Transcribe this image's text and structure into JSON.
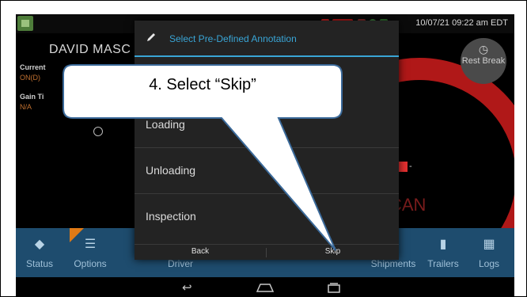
{
  "status_bar": {
    "clock": "10/07/21 09:22 am EDT"
  },
  "background": {
    "driver_name": "DAVID MASC",
    "current_label": "Current",
    "current_value": "ON(D)",
    "gain_label": "Gain Ti",
    "gain_value": "N/A",
    "can_text": "CAN",
    "flag_dash": "-",
    "rest_break": "Rest Break",
    "ring_color": "#b01818"
  },
  "dialog": {
    "title": "Select Pre-Defined Annotation",
    "items": [
      "Loading",
      "Unloading",
      "Inspection"
    ],
    "back_label": "Back",
    "skip_label": "Skip",
    "accent_color": "#39a5d6"
  },
  "bottom_bar": {
    "items": [
      {
        "label": "Status",
        "icon": "diamond-icon"
      },
      {
        "label": "Options",
        "icon": "list-icon"
      },
      {
        "label": "Driver",
        "icon": "driver-icon"
      },
      {
        "label": "Shipments",
        "icon": "box-icon"
      },
      {
        "label": "Trailers",
        "icon": "trailer-icon"
      },
      {
        "label": "Logs",
        "icon": "book-icon"
      }
    ],
    "bar_color": "#1e4c6e"
  },
  "nav_bar": {
    "back_icon": "back-icon",
    "home_icon": "home-icon",
    "recents_icon": "recents-icon"
  },
  "callout": {
    "text": "4. Select “Skip”"
  }
}
